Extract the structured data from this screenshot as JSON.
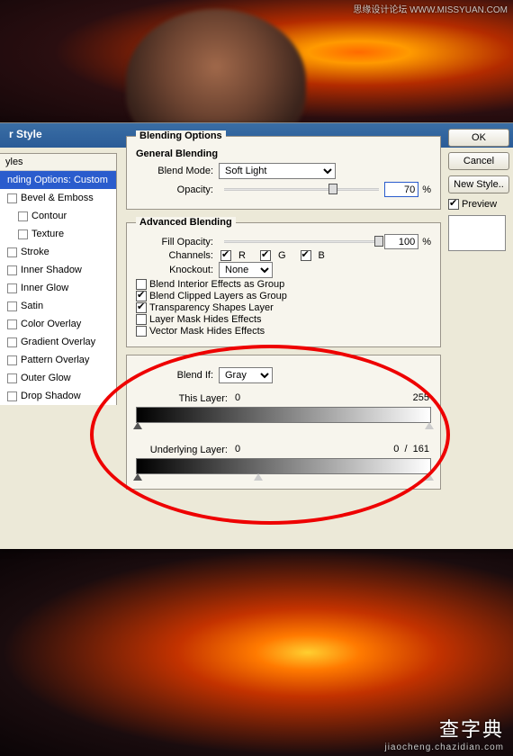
{
  "watermark_top": "思缘设计论坛  WWW.MISSYUAN.COM",
  "watermark_bot": {
    "big": "查字典",
    "small": "jiaocheng.chazidian.com"
  },
  "dialog": {
    "title": "r Style",
    "sidebar": {
      "header": "yles",
      "items": [
        {
          "label": "nding Options: Custom",
          "selected": true,
          "checkbox": false
        },
        {
          "label": "Bevel & Emboss",
          "checkbox": true,
          "checked": false
        },
        {
          "label": "Contour",
          "checkbox": true,
          "checked": false,
          "indent": true
        },
        {
          "label": "Texture",
          "checkbox": true,
          "checked": false,
          "indent": true
        },
        {
          "label": "Stroke",
          "checkbox": true,
          "checked": false
        },
        {
          "label": "Inner Shadow",
          "checkbox": true,
          "checked": false
        },
        {
          "label": "Inner Glow",
          "checkbox": true,
          "checked": false
        },
        {
          "label": "Satin",
          "checkbox": true,
          "checked": false
        },
        {
          "label": "Color Overlay",
          "checkbox": true,
          "checked": false
        },
        {
          "label": "Gradient Overlay",
          "checkbox": true,
          "checked": false
        },
        {
          "label": "Pattern Overlay",
          "checkbox": true,
          "checked": false
        },
        {
          "label": "Outer Glow",
          "checkbox": true,
          "checked": false
        },
        {
          "label": "Drop Shadow",
          "checkbox": true,
          "checked": false
        }
      ]
    },
    "blending_options": {
      "title": "Blending Options",
      "general": {
        "title": "General Blending",
        "blend_mode_label": "Blend Mode:",
        "blend_mode_value": "Soft Light",
        "opacity_label": "Opacity:",
        "opacity_value": "70",
        "pct": "%"
      },
      "advanced": {
        "title": "Advanced Blending",
        "fill_opacity_label": "Fill Opacity:",
        "fill_opacity_value": "100",
        "pct": "%",
        "channels_label": "Channels:",
        "ch_r": "R",
        "ch_g": "G",
        "ch_b": "B",
        "knockout_label": "Knockout:",
        "knockout_value": "None",
        "opts": [
          {
            "label": "Blend Interior Effects as Group",
            "checked": false
          },
          {
            "label": "Blend Clipped Layers as Group",
            "checked": true
          },
          {
            "label": "Transparency Shapes Layer",
            "checked": true
          },
          {
            "label": "Layer Mask Hides Effects",
            "checked": false
          },
          {
            "label": "Vector Mask Hides Effects",
            "checked": false
          }
        ]
      },
      "blendif": {
        "label": "Blend If:",
        "value": "Gray",
        "this_layer_label": "This Layer:",
        "this_vals": {
          "a": "0",
          "b": "255"
        },
        "under_label": "Underlying Layer:",
        "under_vals": {
          "a": "0",
          "b": "0",
          "c": "161",
          "sep": "/"
        }
      }
    },
    "buttons": {
      "ok": "OK",
      "cancel": "Cancel",
      "newstyle": "New Style..",
      "preview": "Preview"
    }
  }
}
